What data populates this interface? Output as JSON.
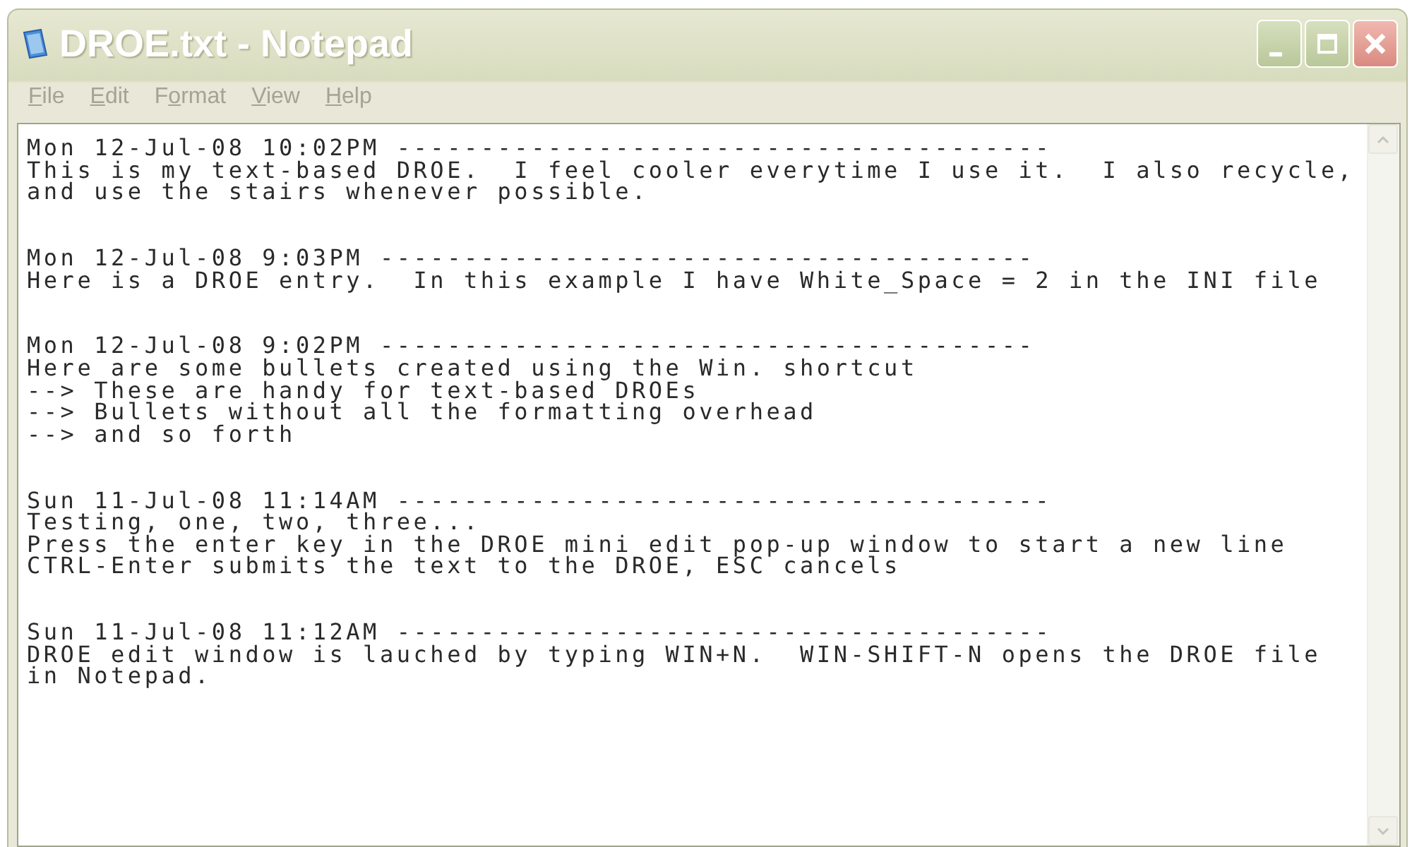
{
  "window": {
    "title": "DROE.txt - Notepad"
  },
  "menu": [
    {
      "mnemonic": "F",
      "rest": "ile"
    },
    {
      "mnemonic": "E",
      "rest": "dit"
    },
    {
      "prefix": "F",
      "mnemonic": "o",
      "rest": "rmat"
    },
    {
      "mnemonic": "V",
      "rest": "iew"
    },
    {
      "mnemonic": "H",
      "rest": "elp"
    }
  ],
  "entries": [
    {
      "header": "Mon 12-Jul-08 10:02PM ---------------------------------------",
      "lines": [
        "This is my text-based DROE.  I feel cooler everytime I use it.  I also recycle,",
        "and use the stairs whenever possible."
      ]
    },
    {
      "header": "Mon 12-Jul-08 9:03PM ---------------------------------------",
      "lines": [
        "Here is a DROE entry.  In this example I have White_Space = 2 in the INI file"
      ]
    },
    {
      "header": "Mon 12-Jul-08 9:02PM ---------------------------------------",
      "lines": [
        "Here are some bullets created using the Win. shortcut",
        "--> These are handy for text-based DROEs",
        "--> Bullets without all the formatting overhead",
        "--> and so forth"
      ]
    },
    {
      "header": "Sun 11-Jul-08 11:14AM ---------------------------------------",
      "lines": [
        "Testing, one, two, three...",
        "Press the enter key in the DROE mini edit pop-up window to start a new line",
        "CTRL-Enter submits the text to the DROE, ESC cancels"
      ]
    },
    {
      "header": "Sun 11-Jul-08 11:12AM ---------------------------------------",
      "lines": [
        "DROE edit window is lauched by typing WIN+N.  WIN-SHIFT-N opens the DROE file",
        "in Notepad."
      ]
    }
  ]
}
